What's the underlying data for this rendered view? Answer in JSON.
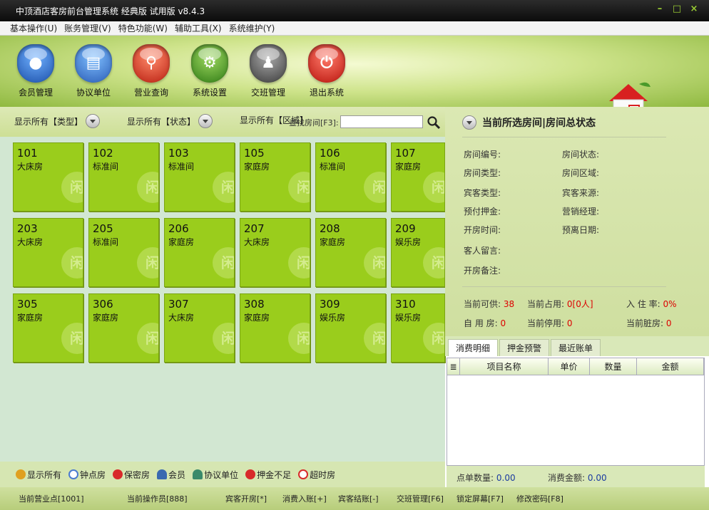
{
  "window": {
    "title": "中顶酒店客房前台管理系统 经典版 试用版 v8.4.3"
  },
  "menu": [
    "基本操作(U)",
    "账务管理(V)",
    "特色功能(W)",
    "辅助工具(X)",
    "系统维护(Y)"
  ],
  "toolbar": [
    {
      "label": "会员管理",
      "icon": "member-icon",
      "color": "#2a6fc9"
    },
    {
      "label": "协议单位",
      "icon": "contract-icon",
      "color": "#3a7fd4"
    },
    {
      "label": "营业查询",
      "icon": "search-icon",
      "color": "#d83a2a"
    },
    {
      "label": "系统设置",
      "icon": "gear-icon",
      "color": "#4a9a2a"
    },
    {
      "label": "交班管理",
      "icon": "shift-icon",
      "color": "#555555"
    },
    {
      "label": "退出系统",
      "icon": "power-icon",
      "color": "#d82a2a"
    }
  ],
  "filters": {
    "type": "显示所有【类型】",
    "status": "显示所有【状态】",
    "area": "显示所有【区域】",
    "search_label": "查找房间[F3]:",
    "search_value": ""
  },
  "rooms": [
    {
      "no": "101",
      "type": "大床房"
    },
    {
      "no": "102",
      "type": "标准间"
    },
    {
      "no": "103",
      "type": "标准间"
    },
    {
      "no": "105",
      "type": "家庭房"
    },
    {
      "no": "106",
      "type": "标准间"
    },
    {
      "no": "107",
      "type": "家庭房"
    },
    {
      "no": "203",
      "type": "大床房"
    },
    {
      "no": "205",
      "type": "标准间"
    },
    {
      "no": "206",
      "type": "家庭房"
    },
    {
      "no": "207",
      "type": "大床房"
    },
    {
      "no": "208",
      "type": "家庭房"
    },
    {
      "no": "209",
      "type": "娱乐房"
    },
    {
      "no": "305",
      "type": "家庭房"
    },
    {
      "no": "306",
      "type": "家庭房"
    },
    {
      "no": "307",
      "type": "大床房"
    },
    {
      "no": "308",
      "type": "家庭房"
    },
    {
      "no": "309",
      "type": "娱乐房"
    },
    {
      "no": "310",
      "type": "娱乐房"
    }
  ],
  "room_watermark": "闲",
  "legend": [
    {
      "label": "显示所有",
      "icon": "sun-icon",
      "color": "#e0a020"
    },
    {
      "label": "钟点房",
      "icon": "clock-icon",
      "color": "#4a7ad0"
    },
    {
      "label": "保密房",
      "icon": "no-entry-icon",
      "color": "#d82a2a"
    },
    {
      "label": "会员",
      "icon": "person-icon",
      "color": "#3a6ab0"
    },
    {
      "label": "协议单位",
      "icon": "people-icon",
      "color": "#3a8a6a"
    },
    {
      "label": "押金不足",
      "icon": "warning-icon",
      "color": "#d82a2a"
    },
    {
      "label": "超时房",
      "icon": "prohibit-icon",
      "color": "#d82a2a"
    }
  ],
  "status_panel": {
    "title": "当前所选房间|房间总状态",
    "fields_left": [
      "房间编号:",
      "房间类型:",
      "宾客类型:",
      "预付押金:",
      "开房时间:",
      "客人留言:",
      "开房备注:"
    ],
    "fields_right": [
      "房间状态:",
      "房间区域:",
      "宾客来源:",
      "营销经理:",
      "预离日期:"
    ],
    "summary": [
      {
        "label": "当前可供:",
        "value": "38"
      },
      {
        "label": "当前占用:",
        "value": "0[0人]"
      },
      {
        "label": "入 住 率:",
        "value": "0%"
      },
      {
        "label": "自 用 房:",
        "value": "0"
      },
      {
        "label": "当前停用:",
        "value": "0"
      },
      {
        "label": "当前脏房:",
        "value": "0"
      }
    ]
  },
  "tabs": [
    "消费明细",
    "押金预警",
    "最近账单"
  ],
  "table_headers": [
    "项目名称",
    "单价",
    "数量",
    "金额"
  ],
  "sums": {
    "count_label": "点单数量:",
    "count_value": "0.00",
    "amount_label": "消费金额:",
    "amount_value": "0.00"
  },
  "statusbar": [
    "当前营业点[1001]",
    "当前操作员[888]",
    "宾客开房[*]",
    "消费入账[+]",
    "宾客结账[-]",
    "交班管理[F6]",
    "锁定屏幕[F7]",
    "修改密码[F8]"
  ]
}
